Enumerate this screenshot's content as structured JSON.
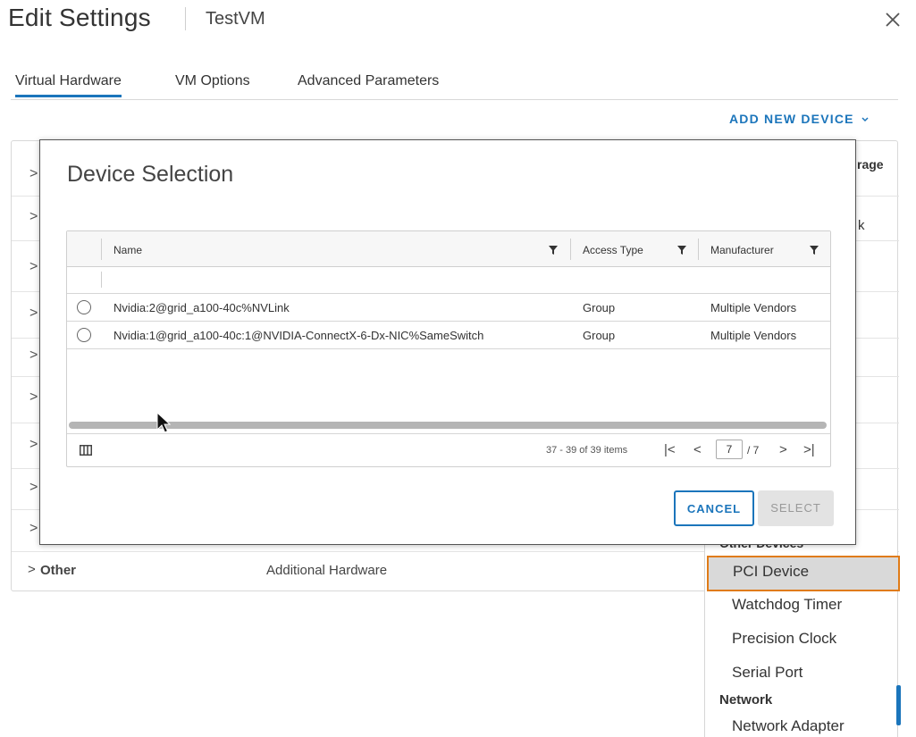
{
  "header": {
    "title": "Edit Settings",
    "vm_name": "TestVM"
  },
  "tabs": [
    {
      "label": "Virtual Hardware",
      "active": true
    },
    {
      "label": "VM Options",
      "active": false
    },
    {
      "label": "Advanced Parameters",
      "active": false
    }
  ],
  "toolbar": {
    "add_new_device": "ADD NEW DEVICE"
  },
  "background": {
    "frag_storage": "rage",
    "frag_disk": "k",
    "other_row": {
      "label": "Other",
      "description": "Additional Hardware"
    }
  },
  "menu": {
    "section_other": "Other Devices",
    "items": [
      "PCI Device",
      "Watchdog Timer",
      "Precision Clock",
      "Serial Port"
    ],
    "section_network": "Network",
    "network_items": [
      "Network Adapter"
    ]
  },
  "modal": {
    "title": "Device Selection",
    "columns": [
      "Name",
      "Access Type",
      "Manufacturer"
    ],
    "rows": [
      {
        "name": "Nvidia:2@grid_a100-40c%NVLink",
        "access_type": "Group",
        "manufacturer": "Multiple Vendors"
      },
      {
        "name": "Nvidia:1@grid_a100-40c:1@NVIDIA-ConnectX-6-Dx-NIC%SameSwitch",
        "access_type": "Group",
        "manufacturer": "Multiple Vendors"
      }
    ],
    "footer": {
      "items_count": "37 - 39 of 39 items",
      "current_page": "7",
      "total_pages": "/ 7"
    },
    "cancel_label": "CANCEL",
    "select_label": "SELECT"
  },
  "colors": {
    "accent": "#1b75bb",
    "highlight_border": "#e07b17"
  },
  "icons": [
    "close-icon",
    "chevron-down-icon",
    "chevron-right-icon",
    "filter-icon",
    "column-toggle-icon",
    "first-page-icon",
    "prev-page-icon",
    "next-page-icon",
    "last-page-icon",
    "mouse-cursor-icon"
  ]
}
